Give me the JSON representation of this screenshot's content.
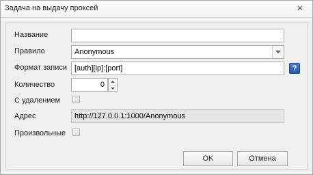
{
  "window": {
    "title": "Задача на выдачу проксей"
  },
  "form": {
    "name_label": "Название",
    "name_value": "",
    "rule_label": "Правило",
    "rule_value": "Anonymous",
    "format_label": "Формат записи",
    "format_value": "[auth][ip]:[port]",
    "help_glyph": "?",
    "count_label": "Количество",
    "count_value": "0",
    "with_delete_label": "С удалением",
    "with_delete_checked": false,
    "address_label": "Адрес",
    "address_value": "http://127.0.0.1:1000/Anonymous",
    "arbitrary_label": "Произвольные",
    "arbitrary_checked": false
  },
  "buttons": {
    "ok": "OK",
    "cancel": "Отмена"
  },
  "icons": {
    "close": "close-icon",
    "dropdown": "chevron-down-icon",
    "help": "help-icon"
  },
  "colors": {
    "help_icon": "#2456b3",
    "window_bg": "#f0f0f0"
  }
}
